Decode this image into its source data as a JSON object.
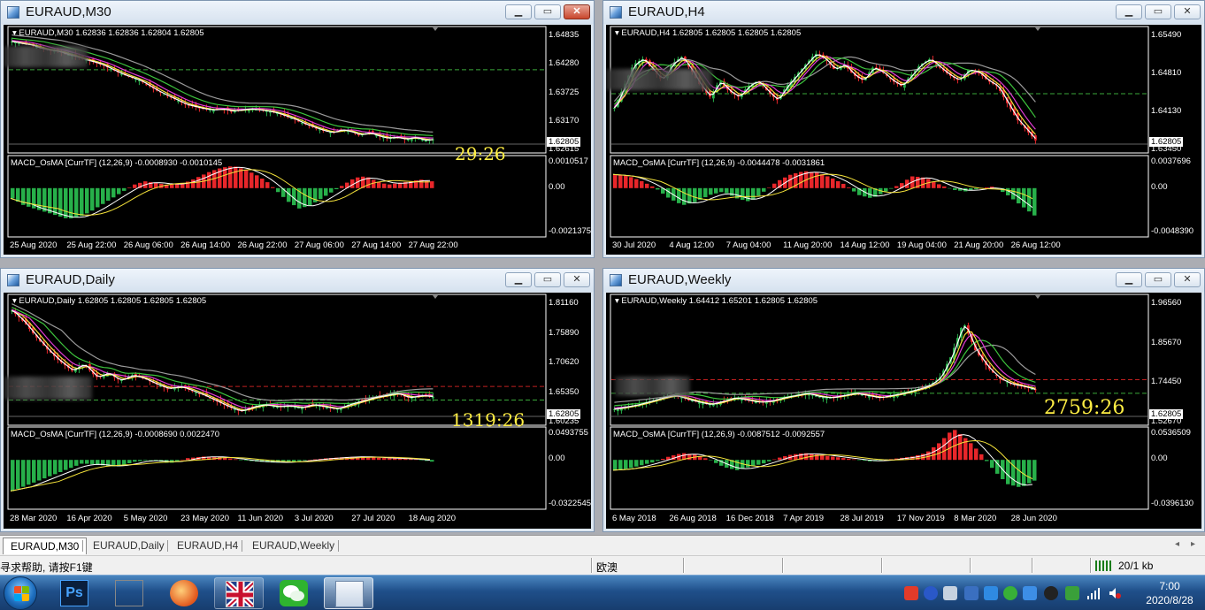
{
  "windows": [
    {
      "title": "EURAUD,M30",
      "symbol_line": "EURAUD,M30  1.62836 1.62836 1.62804 1.62805",
      "indicator_line": "MACD_OsMA [CurrTF] (12,26,9) -0.0008930 -0.0010145",
      "price_labels": [
        "1.64835",
        "1.64280",
        "1.63725",
        "1.63170",
        "1.62615"
      ],
      "current_price": "1.62805",
      "ind_labels": [
        "0.0010517",
        "0.00",
        "-0.0021375"
      ],
      "date_labels": [
        "25 Aug 2020",
        "25 Aug 22:00",
        "26 Aug 06:00",
        "26 Aug 14:00",
        "26 Aug 22:00",
        "27 Aug 06:00",
        "27 Aug 14:00",
        "27 Aug 22:00"
      ],
      "countdown": "29:26",
      "close_active": true,
      "price_series": [
        0.96,
        0.94,
        0.93,
        0.9,
        0.88,
        0.87,
        0.84,
        0.82,
        0.79,
        0.77,
        0.74,
        0.7,
        0.66,
        0.63,
        0.6,
        0.55,
        0.5,
        0.46,
        0.42,
        0.38,
        0.36,
        0.34,
        0.33,
        0.34,
        0.32,
        0.33,
        0.34,
        0.33,
        0.32,
        0.3,
        0.27,
        0.24,
        0.2,
        0.17,
        0.14,
        0.12,
        0.15,
        0.13,
        0.1,
        0.12,
        0.09,
        0.07,
        0.08,
        0.06,
        0.08,
        0.05,
        0.06
      ],
      "macd_series": [
        -0.3,
        -0.5,
        -0.6,
        -0.7,
        -0.8,
        -0.9,
        -0.85,
        -0.7,
        -0.5,
        -0.3,
        -0.1,
        0.1,
        0.2,
        0.15,
        0.1,
        0.12,
        0.2,
        0.35,
        0.5,
        0.6,
        0.65,
        0.55,
        0.4,
        0.2,
        -0.1,
        -0.4,
        -0.6,
        -0.5,
        -0.3,
        -0.1,
        0.1,
        0.3,
        0.35,
        0.2,
        0.1,
        0.15,
        0.2,
        0.25,
        0.2
      ]
    },
    {
      "title": "EURAUD,H4",
      "symbol_line": "EURAUD,H4  1.62805 1.62805 1.62805 1.62805",
      "indicator_line": "MACD_OsMA [CurrTF] (12,26,9) -0.0044478 -0.0031861",
      "price_labels": [
        "1.65490",
        "1.64810",
        "1.64130",
        "1.63450"
      ],
      "current_price": "1.62805",
      "ind_labels": [
        "0.0037696",
        "0.00",
        "-0.0048390"
      ],
      "date_labels": [
        "30 Jul 2020",
        "4 Aug 12:00",
        "7 Aug 04:00",
        "11 Aug 20:00",
        "14 Aug 12:00",
        "19 Aug 04:00",
        "21 Aug 20:00",
        "26 Aug 12:00"
      ],
      "countdown": "",
      "close_active": false,
      "price_series": [
        0.35,
        0.55,
        0.75,
        0.8,
        0.7,
        0.6,
        0.75,
        0.82,
        0.7,
        0.55,
        0.45,
        0.6,
        0.5,
        0.45,
        0.55,
        0.6,
        0.5,
        0.42,
        0.55,
        0.65,
        0.75,
        0.85,
        0.8,
        0.7,
        0.75,
        0.65,
        0.6,
        0.72,
        0.68,
        0.6,
        0.55,
        0.65,
        0.75,
        0.8,
        0.72,
        0.65,
        0.6,
        0.7,
        0.68,
        0.6,
        0.55,
        0.4,
        0.25,
        0.15,
        0.05
      ],
      "macd_series": [
        0.4,
        0.35,
        0.2,
        0.0,
        -0.3,
        -0.5,
        -0.4,
        -0.2,
        -0.1,
        -0.3,
        -0.4,
        -0.1,
        0.2,
        0.4,
        0.5,
        0.45,
        0.3,
        0.1,
        -0.2,
        -0.3,
        -0.1,
        0.1,
        0.35,
        0.3,
        0.1,
        -0.05,
        -0.1,
        0.0,
        0.05,
        -0.2,
        -0.5,
        -0.8
      ]
    },
    {
      "title": "EURAUD,Daily",
      "symbol_line": "EURAUD,Daily  1.62805 1.62805 1.62805 1.62805",
      "indicator_line": "MACD_OsMA [CurrTF] (12,26,9) -0.0008690 0.0022470",
      "price_labels": [
        "1.81160",
        "1.75890",
        "1.70620",
        "1.65350",
        "1.60235"
      ],
      "current_price": "1.62805",
      "ind_labels": [
        "0.0493755",
        "0.00",
        "-0.0322545"
      ],
      "date_labels": [
        "28 Mar 2020",
        "16 Apr 2020",
        "5 May 2020",
        "23 May 2020",
        "11 Jun 2020",
        "3 Jul 2020",
        "27 Jul 2020",
        "18 Aug 2020"
      ],
      "countdown": "1319:26",
      "close_active": false,
      "price_series": [
        0.95,
        0.85,
        0.72,
        0.6,
        0.5,
        0.42,
        0.48,
        0.36,
        0.4,
        0.33,
        0.38,
        0.35,
        0.3,
        0.26,
        0.28,
        0.24,
        0.2,
        0.15,
        0.1,
        0.06,
        0.1,
        0.12,
        0.1,
        0.11,
        0.09,
        0.12,
        0.1,
        0.08,
        0.12,
        0.15,
        0.18,
        0.2,
        0.22,
        0.18,
        0.2,
        0.19
      ],
      "macd_series": [
        -0.9,
        -0.7,
        -0.5,
        -0.3,
        -0.1,
        -0.15,
        -0.2,
        -0.05,
        0.0,
        -0.1,
        0.05,
        0.1,
        0.08,
        0.0,
        -0.05,
        -0.08,
        -0.06,
        0.0,
        0.05,
        0.08,
        0.1,
        0.06,
        0.04,
        0.02,
        -0.05
      ]
    },
    {
      "title": "EURAUD,Weekly",
      "symbol_line": "EURAUD,Weekly  1.64412 1.65201 1.62805 1.62805",
      "indicator_line": "MACD_OsMA [CurrTF] (12,26,9) -0.0087512 -0.0092557",
      "price_labels": [
        "1.96560",
        "1.85670",
        "1.74450",
        "1.52670"
      ],
      "current_price": "1.62805",
      "ind_labels": [
        "0.0536509",
        "0.00",
        "-0.0396130"
      ],
      "date_labels": [
        "6 May 2018",
        "26 Aug 2018",
        "16 Dec 2018",
        "7 Apr 2019",
        "28 Jul 2019",
        "17 Nov 2019",
        "8 Mar 2020",
        "28 Jun 2020"
      ],
      "countdown": "2759:26",
      "close_active": false,
      "price_series": [
        0.08,
        0.1,
        0.12,
        0.15,
        0.18,
        0.2,
        0.17,
        0.14,
        0.12,
        0.15,
        0.18,
        0.16,
        0.14,
        0.15,
        0.18,
        0.2,
        0.22,
        0.19,
        0.18,
        0.2,
        0.22,
        0.2,
        0.18,
        0.2,
        0.22,
        0.25,
        0.28,
        0.35,
        0.55,
        0.85,
        0.6,
        0.45,
        0.35,
        0.3,
        0.28,
        0.25
      ],
      "macd_series": [
        -0.3,
        -0.25,
        -0.15,
        -0.05,
        0.1,
        0.2,
        0.15,
        0.0,
        -0.2,
        -0.3,
        -0.2,
        -0.1,
        0.05,
        0.15,
        0.2,
        0.15,
        0.1,
        0.05,
        0.0,
        -0.05,
        0.0,
        0.05,
        0.1,
        0.2,
        0.5,
        0.9,
        0.6,
        0.2,
        -0.3,
        -0.7,
        -0.8,
        -0.6
      ]
    }
  ],
  "tabs": [
    {
      "label": "EURAUD,M30",
      "active": true
    },
    {
      "label": "EURAUD,Daily",
      "active": false
    },
    {
      "label": "EURAUD,H4",
      "active": false
    },
    {
      "label": "EURAUD,Weekly",
      "active": false
    }
  ],
  "status": {
    "help": "寻求帮助, 请按F1键",
    "profile": "欧澳",
    "traffic": "20/1 kb"
  },
  "taskbar": {
    "clock_time": "7:00",
    "clock_date": "2020/8/28"
  },
  "colors": {
    "bull": "#27b04a",
    "bear": "#e8262a",
    "ma_white": "#ffffff",
    "ma_yellow": "#f4e23a",
    "ma_magenta": "#e23bd6",
    "ma_green": "#3dc43d",
    "ma_gray": "#9a9a9a",
    "level_line": "#3aa83a"
  }
}
